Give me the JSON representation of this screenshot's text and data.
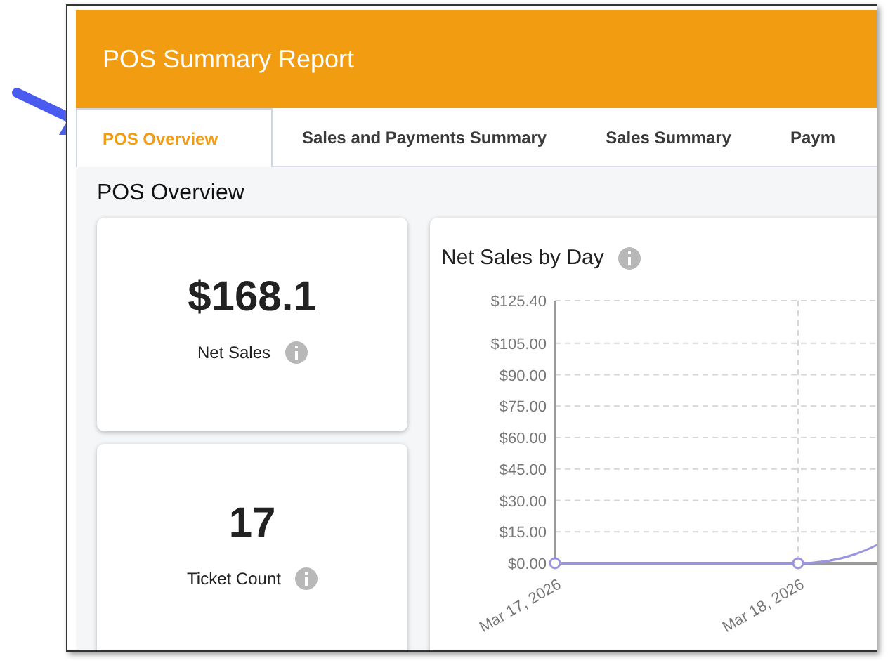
{
  "header": {
    "title": "POS Summary Report"
  },
  "tabs": [
    {
      "label": "POS Overview",
      "selected": true
    },
    {
      "label": "Sales and Payments Summary",
      "selected": false
    },
    {
      "label": "Sales Summary",
      "selected": false
    },
    {
      "label": "Paym",
      "selected": false
    }
  ],
  "section_title": "POS Overview",
  "kpis": [
    {
      "value": "$168.1",
      "label": "Net Sales"
    },
    {
      "value": "17",
      "label": "Ticket Count"
    }
  ],
  "chart": {
    "title": "Net Sales by Day",
    "chart_data": {
      "type": "line",
      "categories": [
        "Mar 17, 2026",
        "Mar 18, 2026"
      ],
      "series": [
        {
          "color": "#9b95e0",
          "marker": true,
          "values": [
            0,
            0
          ]
        }
      ],
      "grid": true,
      "ylim": [
        0,
        125.4
      ],
      "yticks": [
        {
          "value": 0,
          "label": "$0.00"
        },
        {
          "value": 15,
          "label": "$15.00"
        },
        {
          "value": 30,
          "label": "$30.00"
        },
        {
          "value": 45,
          "label": "$45.00"
        },
        {
          "value": 60,
          "label": "$60.00"
        },
        {
          "value": 75,
          "label": "$75.00"
        },
        {
          "value": 90,
          "label": "$90.00"
        },
        {
          "value": 105,
          "label": "$105.00"
        },
        {
          "value": 125.4,
          "label": "$125.40"
        }
      ]
    }
  }
}
